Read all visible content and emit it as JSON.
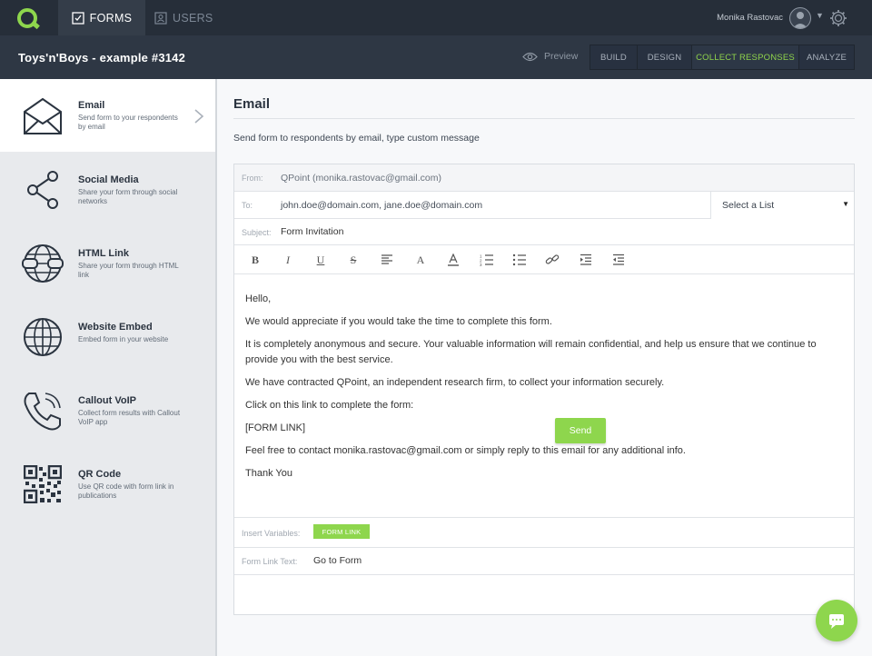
{
  "topnav": {
    "forms_label": "FORMS",
    "users_label": "USERS",
    "user_name": "Monika Rastovac"
  },
  "subnav": {
    "form_title": "Toys'n'Boys - example #3142",
    "preview_label": "Preview",
    "tabs": [
      {
        "label": "BUILD",
        "active": false
      },
      {
        "label": "DESIGN",
        "active": false
      },
      {
        "label": "COLLECT RESPONSES",
        "active": true
      },
      {
        "label": "ANALYZE",
        "active": false
      }
    ]
  },
  "sidebar": {
    "items": [
      {
        "title": "Email",
        "desc": "Send form to your respondents by email",
        "icon": "envelope-icon",
        "active": true
      },
      {
        "title": "Social Media",
        "desc": "Share your form through social networks",
        "icon": "share-icon",
        "active": false
      },
      {
        "title": "HTML Link",
        "desc": "Share your form through HTML link",
        "icon": "globe-link-icon",
        "active": false
      },
      {
        "title": "Website Embed",
        "desc": "Embed form in your website",
        "icon": "globe-icon",
        "active": false
      },
      {
        "title": "Callout VoIP",
        "desc": "Collect form results with Callout VoIP app",
        "icon": "phone-icon",
        "active": false
      },
      {
        "title": "QR Code",
        "desc": "Use QR code with form link in publications",
        "icon": "qr-code-icon",
        "active": false
      }
    ]
  },
  "main": {
    "title": "Email",
    "subtitle": "Send form to respondents by email, type custom message",
    "from_label": "From:",
    "from_value": "QPoint (monika.rastovac@gmail.com)",
    "to_label": "To:",
    "to_value": "john.doe@domain.com, jane.doe@domain.com",
    "select_list": "Select a List",
    "subject_label": "Subject:",
    "subject_value": "Form Invitation",
    "toolbar": [
      "bold-icon",
      "italic-icon",
      "underline-icon",
      "strikethrough-icon",
      "align-icon",
      "font-size-icon",
      "font-color-icon",
      "ordered-list-icon",
      "unordered-list-icon",
      "link-icon",
      "indent-icon",
      "outdent-icon"
    ],
    "body": {
      "greeting": "Hello,",
      "p1": "We would appreciate if you would take the time to complete this form.",
      "p2": "It is completely anonymous and secure. Your valuable information will remain confidential, and help us ensure that we continue to provide you with the best service.",
      "p3": "We have contracted QPoint, an independent research firm, to collect your information securely.",
      "p4": "Click on this link to complete the form:",
      "p5": "[FORM LINK]",
      "p6": "Feel free to contact monika.rastovac@gmail.com or simply reply to this email for any additional info.",
      "p7": "Thank You"
    },
    "insert_label": "Insert Variables:",
    "insert_chip": "FORM LINK",
    "link_text_label": "Form Link Text:",
    "link_text_value": "Go to Form",
    "send_label": "Send"
  },
  "colors": {
    "accent": "#8ed64d",
    "topbar": "#262e39",
    "subbar": "#2e3744"
  }
}
